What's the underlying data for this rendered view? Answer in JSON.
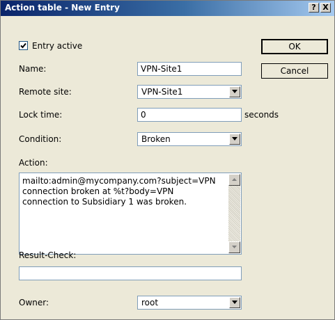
{
  "window": {
    "title": "Action table - New Entry",
    "help_label": "?",
    "close_label": "X"
  },
  "entry_active": {
    "label": "Entry active",
    "checked": true
  },
  "buttons": {
    "ok": "OK",
    "cancel": "Cancel"
  },
  "name": {
    "label": "Name:",
    "value": "VPN-Site1"
  },
  "remote_site": {
    "label": "Remote site:",
    "value": "VPN-Site1"
  },
  "lock_time": {
    "label": "Lock time:",
    "value": "0",
    "unit": "seconds"
  },
  "condition": {
    "label": "Condition:",
    "value": "Broken"
  },
  "action": {
    "label": "Action:",
    "value": "mailto:admin@mycompany.com?subject=VPN\nconnection broken at %t?body=VPN\nconnection to Subsidiary 1 was broken."
  },
  "result_check": {
    "label": "Result-Check:",
    "value": ""
  },
  "owner": {
    "label": "Owner:",
    "value": "root"
  },
  "icons": {
    "combo_arrow": "chevron-down-icon",
    "scroll_up": "arrow-up-icon",
    "scroll_down": "arrow-down-icon",
    "check": "checkmark-icon"
  }
}
